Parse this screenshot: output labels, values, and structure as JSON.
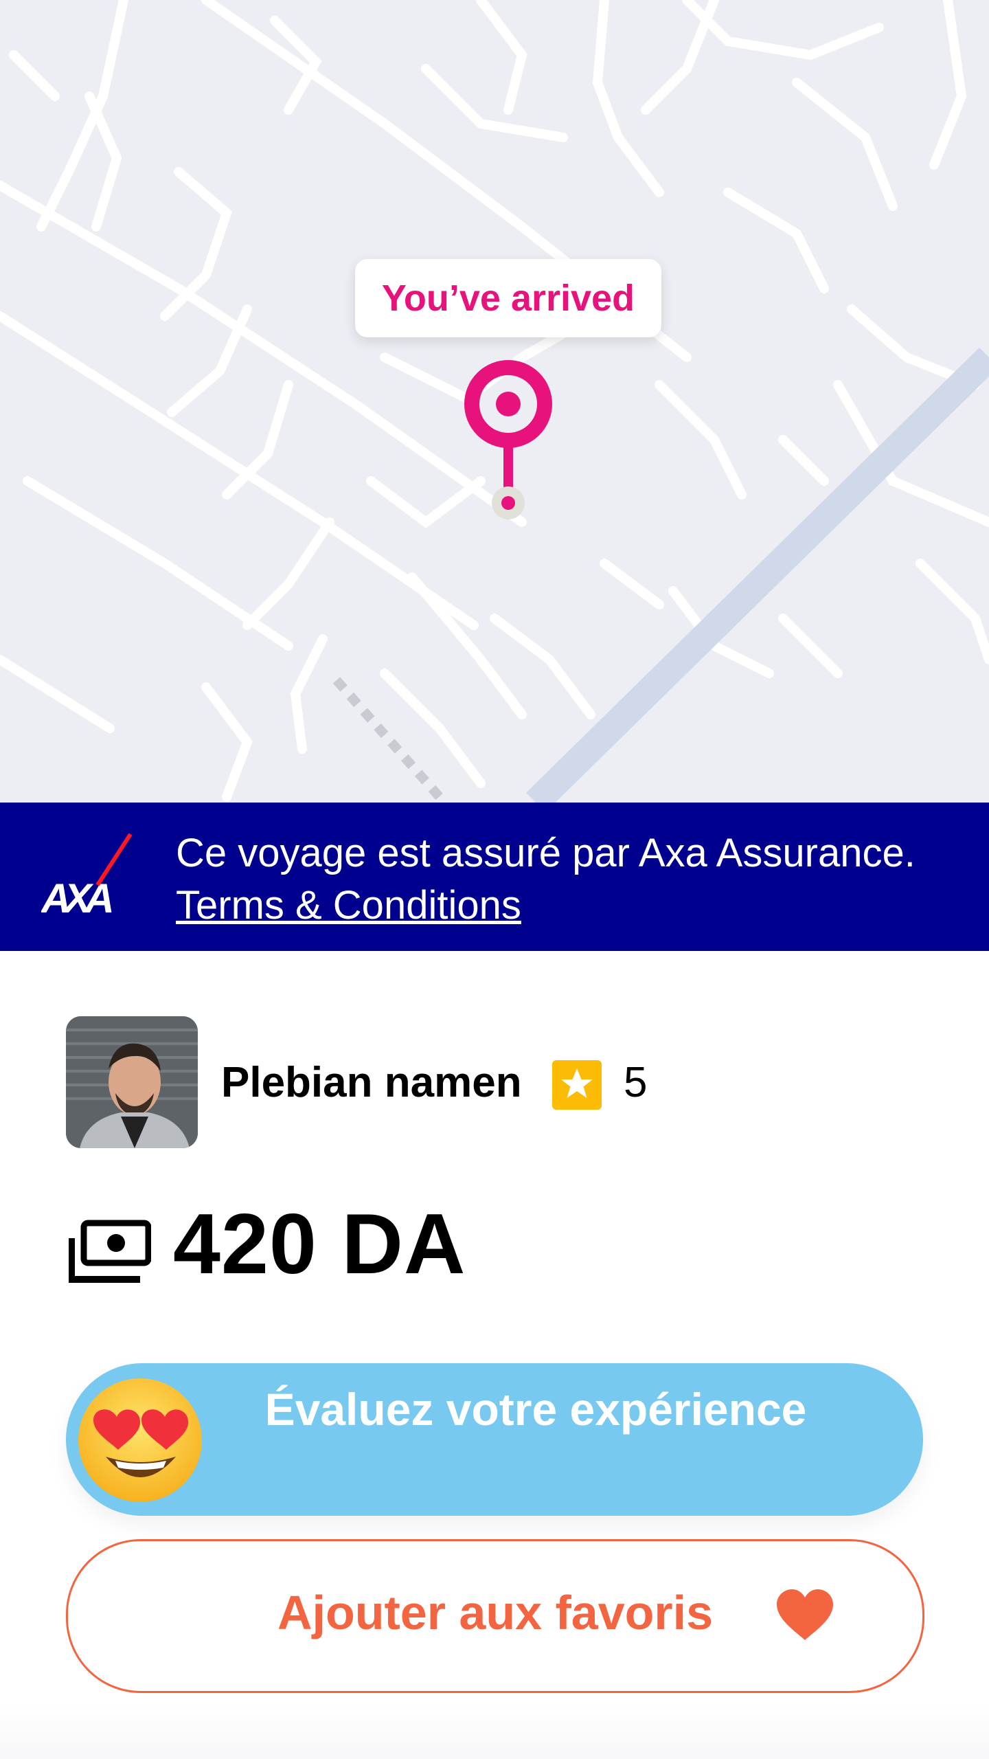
{
  "map": {
    "arrival_label": "You’ve arrived",
    "pin_icon": "location-pin-icon",
    "pin_color": "#e8127c"
  },
  "insurance_banner": {
    "logo": "AXA",
    "text": "Ce voyage est assuré par Axa Assurance. ",
    "link_text": "Terms & Conditions",
    "background": "#00008f"
  },
  "driver": {
    "name": "Plebian namen",
    "rating": "5",
    "star_icon": "star-icon",
    "star_color": "#fcbc05"
  },
  "fare": {
    "amount": "420 DA",
    "icon": "money-icon"
  },
  "rate_button": {
    "label": "Évaluez votre expérience",
    "icon": "heart-eyes-emoji-icon",
    "color": "#78c9ef"
  },
  "favorite_button": {
    "label": "Ajouter aux favoris",
    "icon": "heart-icon",
    "color": "#f26540"
  }
}
